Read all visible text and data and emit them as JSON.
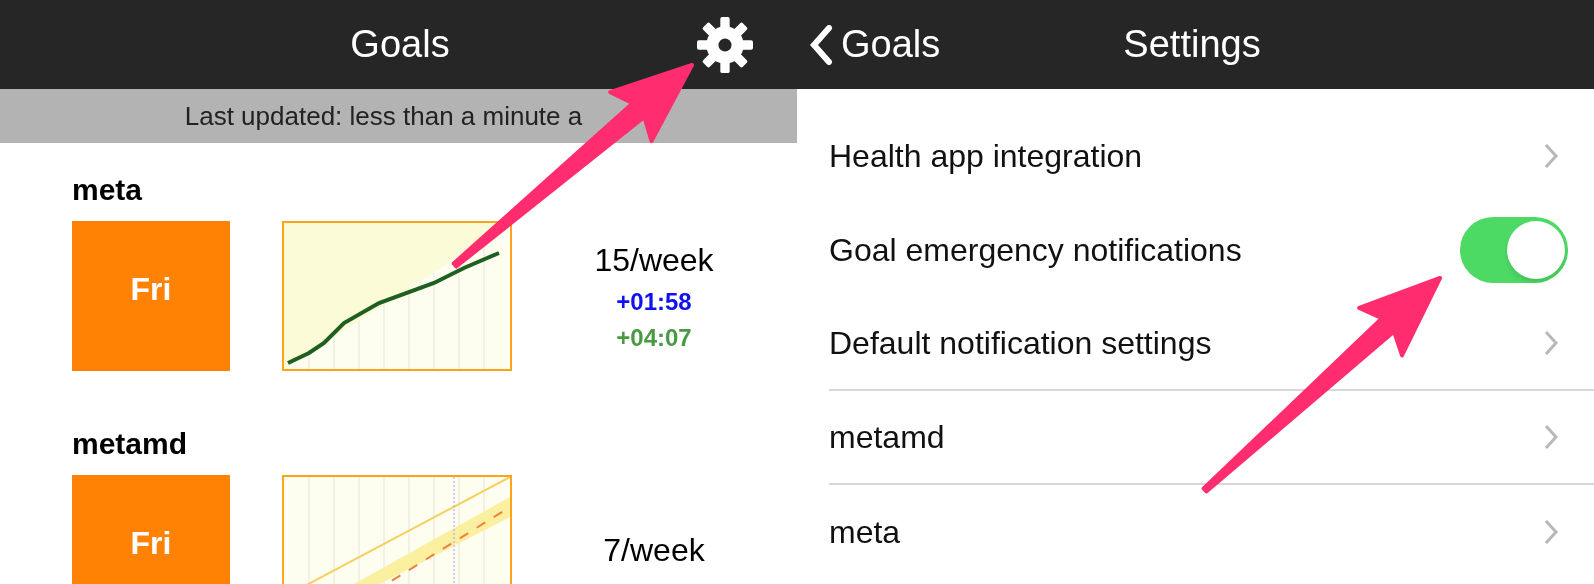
{
  "goals_screen": {
    "title": "Goals",
    "status": "Last updated: less than a minute a",
    "goals": [
      {
        "name": "meta",
        "kind": "line",
        "deadline": "Fri",
        "rate": "15/week",
        "deltas": [
          {
            "text": "+01:58",
            "color": "#1010f0"
          },
          {
            "text": "+04:07",
            "color": "#4a9a44"
          }
        ]
      },
      {
        "name": "metamd",
        "kind": "road",
        "deadline": "Fri",
        "rate": "7/week"
      }
    ]
  },
  "settings_screen": {
    "back": "Goals",
    "title": "Settings",
    "rows": [
      {
        "kind": "link",
        "label": "Health app integration",
        "divider": false
      },
      {
        "kind": "toggle",
        "label": "Goal emergency notifications",
        "on": true,
        "divider": false
      },
      {
        "kind": "link",
        "label": "Default notification settings",
        "divider": true
      },
      {
        "kind": "link",
        "label": "metamd",
        "divider": true
      },
      {
        "kind": "link",
        "label": "meta",
        "divider": false
      }
    ]
  }
}
